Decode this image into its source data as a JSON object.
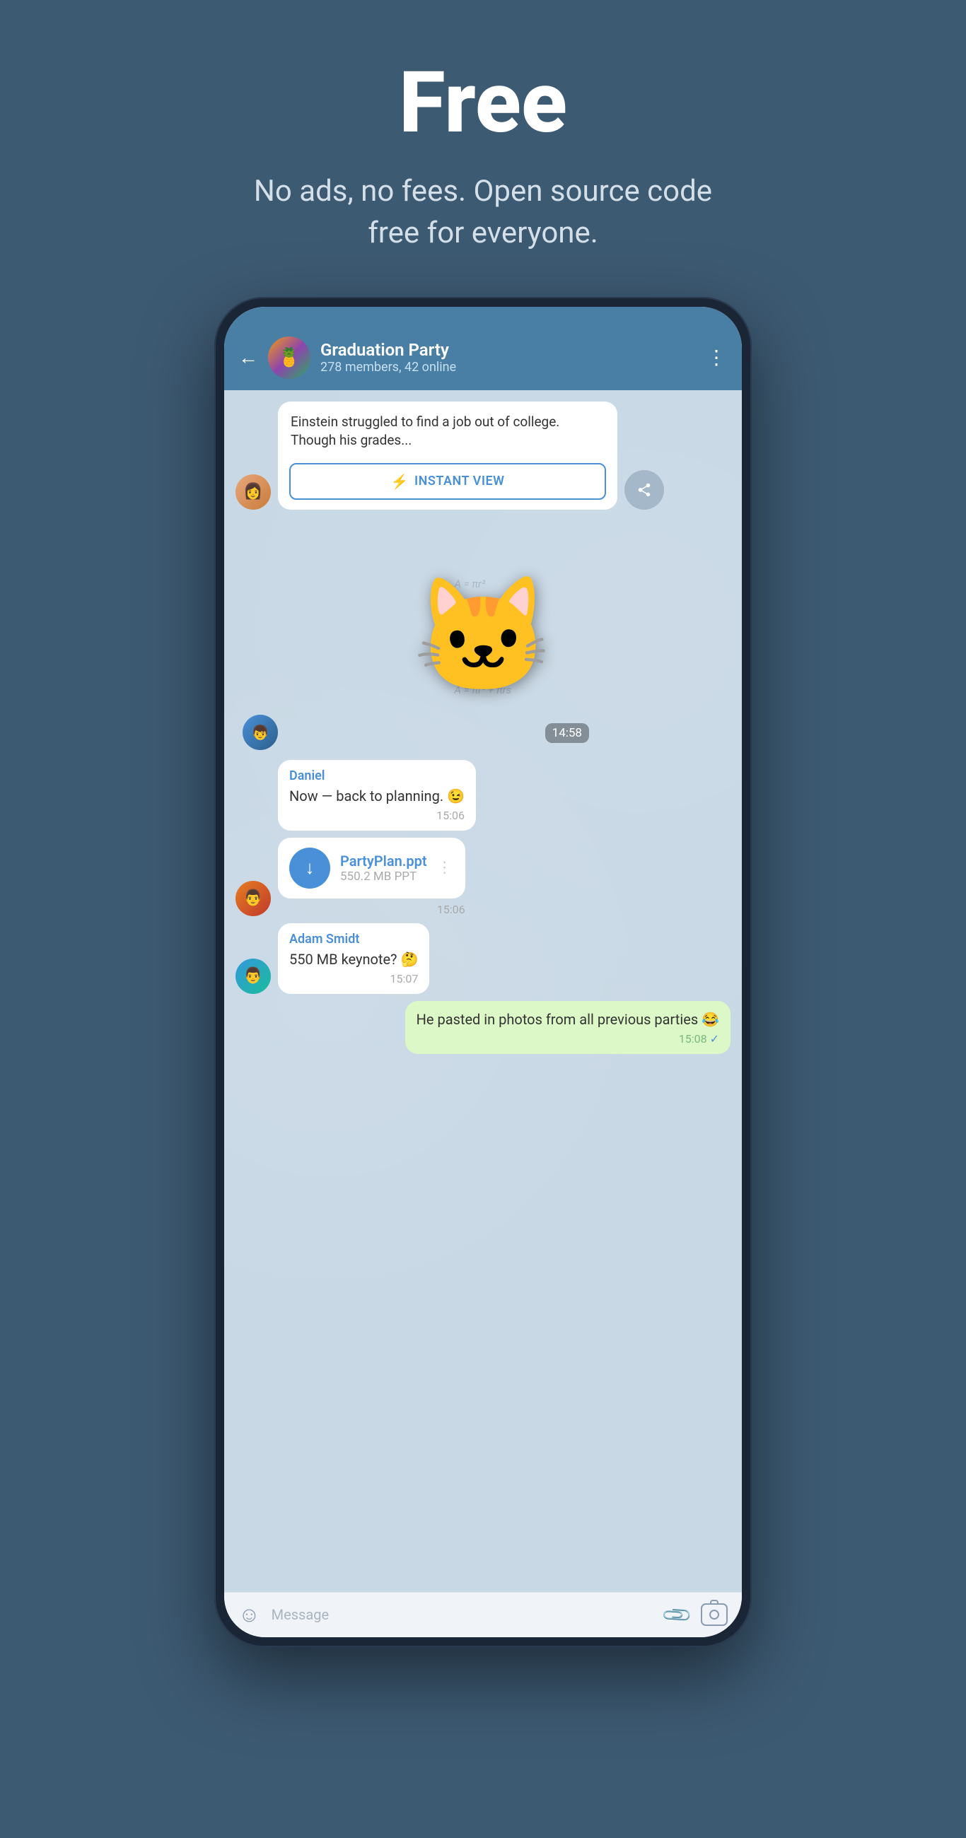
{
  "hero": {
    "title": "Free",
    "subtitle": "No ads, no fees. Open source code free for everyone."
  },
  "phone": {
    "header": {
      "back_label": "←",
      "chat_name": "Graduation Party",
      "chat_members": "278 members, 42 online",
      "menu_label": "⋮",
      "avatar_emoji": "🍍"
    },
    "messages": [
      {
        "type": "article",
        "text": "Einstein struggled to find a job out of college. Though his grades...",
        "instant_view_label": "INSTANT VIEW"
      },
      {
        "type": "sticker",
        "time": "14:58"
      },
      {
        "type": "bubble",
        "sender": "Daniel",
        "text": "Now — back to planning. 😉",
        "time": "15:06"
      },
      {
        "type": "file",
        "filename": "PartyPlan.ppt",
        "filesize": "550.2 MB PPT",
        "time": "15:06"
      },
      {
        "type": "bubble",
        "sender": "Adam Smidt",
        "text": "550 MB keynote? 🤔",
        "time": "15:07"
      },
      {
        "type": "bubble_self",
        "text": "He pasted in photos from all previous parties 😂",
        "time": "15:08",
        "read": true
      }
    ],
    "input": {
      "placeholder": "Message",
      "emoji_label": "☺",
      "attach_label": "📎",
      "camera_label": "📷"
    }
  }
}
